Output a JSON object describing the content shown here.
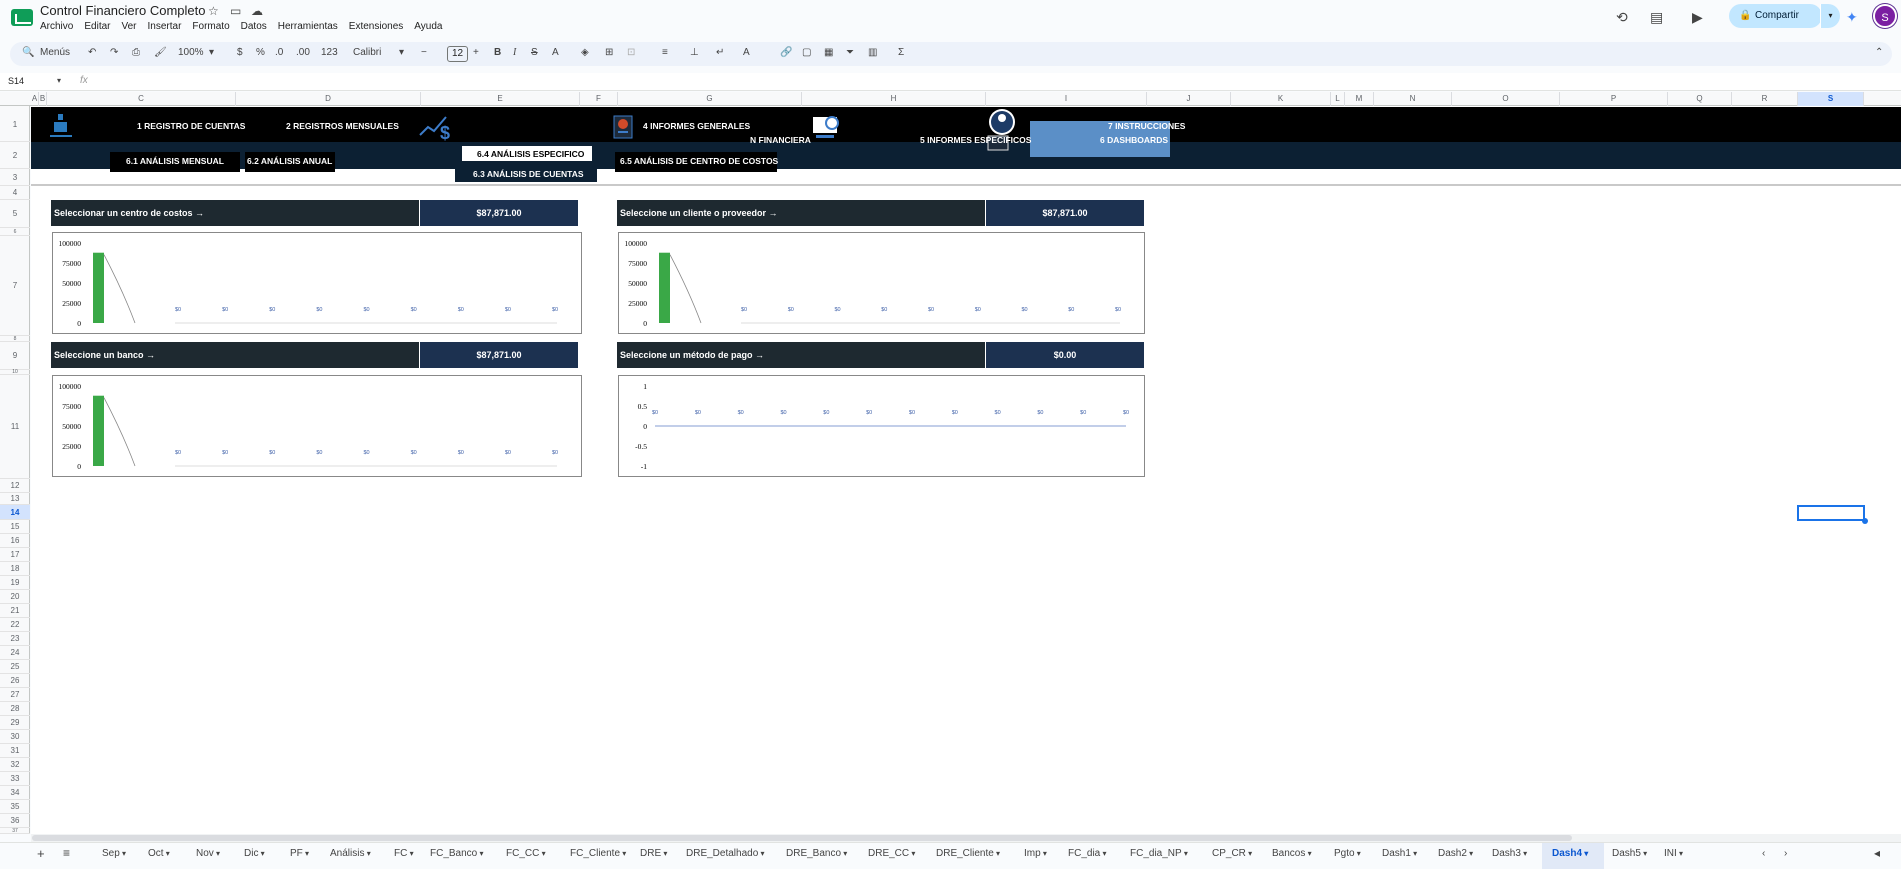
{
  "app": {
    "title": "Control Financiero Completo",
    "menu": [
      "Archivo",
      "Editar",
      "Ver",
      "Insertar",
      "Formato",
      "Datos",
      "Herramientas",
      "Extensiones",
      "Ayuda"
    ],
    "share_label": "Compartir",
    "avatar_letter": "S"
  },
  "toolbar": {
    "menus_label": "Menús",
    "zoom": "100%",
    "currency": "$",
    "percent": "%",
    "dec_less": ".0",
    "dec_more": ".00",
    "number_format": "123",
    "font": "Calibri",
    "font_size": "12",
    "bold": "B",
    "italic": "I",
    "strike": "S",
    "text_color": "A",
    "sum": "Σ"
  },
  "formula_bar": {
    "name_box": "S14",
    "fx": "fx"
  },
  "columns": [
    "A",
    "B",
    "C",
    "D",
    "E",
    "F",
    "G",
    "H",
    "I",
    "J",
    "K",
    "L",
    "M",
    "N",
    "O",
    "P",
    "Q",
    "R",
    "S"
  ],
  "rows": [
    "1",
    "2",
    "3",
    "4",
    "5",
    "6",
    "7",
    "8",
    "9",
    "10",
    "11",
    "12",
    "13",
    "14",
    "15",
    "16",
    "17",
    "18",
    "19",
    "20",
    "21",
    "22",
    "23",
    "24",
    "25",
    "26",
    "27",
    "28",
    "29",
    "30",
    "31",
    "32",
    "33",
    "34",
    "35",
    "36",
    "37"
  ],
  "nav": {
    "link1": "1 REGISTRO DE CUENTAS",
    "link2": "2 REGISTROS MENSUALES",
    "link4": "4 INFORMES GENERALES",
    "link3": "N FINANCIERA",
    "link5": "5 INFORMES ESPECIFICOS",
    "link7": "7 INSTRUCCIONES",
    "link6": "6 DASHBOARDS",
    "sub61": "6.1 ANÁLISIS MENSUAL",
    "sub62": "6.2 ANÁLISIS ANUAL",
    "sub64": "6.4 ANÁLISIS ESPECIFICO",
    "sub63": "6.3 ANÁLISIS DE CUENTAS",
    "sub65": "6.5 ANÁLISIS DE CENTRO DE COSTOS"
  },
  "panels": {
    "cost_center": {
      "label": "Seleccionar un centro de costos →",
      "value": "$87,871.00"
    },
    "client": {
      "label": "Seleccione un cliente o proveedor →",
      "value": "$87,871.00"
    },
    "bank": {
      "label": "Seleccione un banco →",
      "value": "$87,871.00"
    },
    "payment": {
      "label": "Seleccione un método de pago →",
      "value": "$0.00"
    }
  },
  "colors": {
    "bar": "#3aa847",
    "header_dark": "#1e2930",
    "header_value": "#1c3150",
    "banner": "#000000",
    "banner_sub": "#0c2033",
    "accent": "#5b8fc7"
  },
  "chart_data": [
    {
      "type": "bar",
      "yticks": [
        "100000",
        "75000",
        "50000",
        "25000",
        "0"
      ],
      "ylim": [
        0,
        100000
      ],
      "values": [
        87871,
        0,
        0,
        0,
        0,
        0,
        0,
        0,
        0,
        0,
        0,
        0
      ],
      "data_labels": [
        "",
        "$0",
        "$0",
        "$0",
        "$0",
        "$0",
        "$0",
        "$0",
        "$0",
        "$0"
      ],
      "trendline": true
    },
    {
      "type": "bar",
      "yticks": [
        "100000",
        "75000",
        "50000",
        "25000",
        "0"
      ],
      "ylim": [
        0,
        100000
      ],
      "values": [
        87871,
        0,
        0,
        0,
        0,
        0,
        0,
        0,
        0,
        0,
        0,
        0
      ],
      "data_labels": [
        "",
        "$0",
        "$0",
        "$0",
        "$0",
        "$0",
        "$0",
        "$0",
        "$0",
        "$0"
      ],
      "trendline": true
    },
    {
      "type": "bar",
      "yticks": [
        "100000",
        "75000",
        "50000",
        "25000",
        "0"
      ],
      "ylim": [
        0,
        100000
      ],
      "values": [
        87871,
        0,
        0,
        0,
        0,
        0,
        0,
        0,
        0,
        0,
        0,
        0
      ],
      "data_labels": [
        "",
        "$0",
        "$0",
        "$0",
        "$0",
        "$0",
        "$0",
        "$0",
        "$0",
        "$0"
      ],
      "trendline": true
    },
    {
      "type": "line",
      "yticks": [
        "1",
        "0.5",
        "0",
        "-0.5",
        "-1"
      ],
      "ylim": [
        -1,
        1
      ],
      "values": [
        0,
        0,
        0,
        0,
        0,
        0,
        0,
        0,
        0,
        0,
        0,
        0
      ],
      "data_labels": [
        "$0",
        "$0",
        "$0",
        "$0",
        "$0",
        "$0",
        "$0",
        "$0",
        "$0",
        "$0",
        "$0",
        "$0"
      ]
    }
  ],
  "sheet_tabs": [
    "Sep",
    "Oct",
    "Nov",
    "Dic",
    "PF",
    "Análisis",
    "FC",
    "FC_Banco",
    "FC_CC",
    "FC_Cliente",
    "DRE",
    "DRE_Detalhado",
    "DRE_Banco",
    "DRE_CC",
    "DRE_Cliente",
    "Imp",
    "FC_dia",
    "FC_dia_NP",
    "CP_CR",
    "Bancos",
    "Pgto",
    "Dash1",
    "Dash2",
    "Dash3",
    "Dash4",
    "Dash5",
    "INI"
  ],
  "active_tab": "Dash4"
}
